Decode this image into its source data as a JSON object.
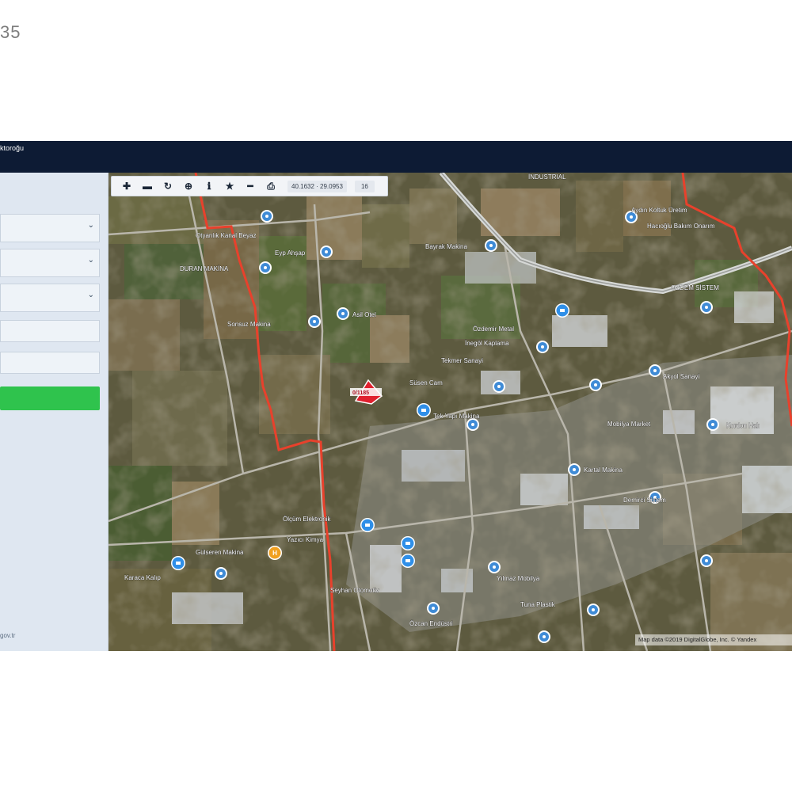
{
  "page": {
    "corner_text": "35"
  },
  "header": {
    "title": "ktoroğu"
  },
  "sidebar": {
    "dropdowns": [
      {
        "name": "dropdown-1"
      },
      {
        "name": "dropdown-2"
      },
      {
        "name": "dropdown-3"
      }
    ],
    "footer_text": "gov.tr"
  },
  "toolbar": {
    "buttons": [
      "zoom-in",
      "zoom-out",
      "refresh",
      "locate",
      "info",
      "bookmark",
      "measure",
      "print"
    ],
    "coordinates": "40.1632 · 29.0953",
    "zoom_level": "16"
  },
  "map": {
    "attribution": "Map data ©2019 DigitalGlobe, Inc. © Yandex",
    "colors": {
      "boundary": "#e8412c",
      "marker": "#3f8bd6",
      "marker_active": "#2f8fe8",
      "hotel": "#f0a020",
      "parcel": "#e0202e"
    },
    "labels": {
      "l1": "İNDUSTRIAL",
      "l2": "Otyanlık Kanal Beyaz",
      "l3": "Eyp Ahşap",
      "l4": "Bayrak Makina",
      "l5": "DURAN MAKİNA",
      "l6": "Sonsuz Makina",
      "l7": "Asil Otel",
      "l8": "Özdemir Metal",
      "l9": "Aydın Koltuk Üretim",
      "l10": "Hacıoğlu Bakım Onarım",
      "l11": "İnegöl Kaplama",
      "l12": "Tekmer Sanayi",
      "l13": "Süsen Cam",
      "l14": "Tek Yapı Makina",
      "l15": "Mobilya Market",
      "l16": "Kordon Halı",
      "l17": "Akyol Sanayi",
      "l18": "Kartal Makina",
      "l19": "Demirci Sistem",
      "l20": "Ölçüm Elektronik",
      "l21": "Yazıcı Kimya",
      "l22": "Gülseren Makina",
      "l23": "Karaca Kalıp",
      "l24": "Seyhan Otomotiv",
      "l25": "Yılmaz Mobilya",
      "l26": "Tuna Plastik",
      "l27": "Özcan Endüstri",
      "l28": "OZDEM SİSTEM"
    }
  }
}
